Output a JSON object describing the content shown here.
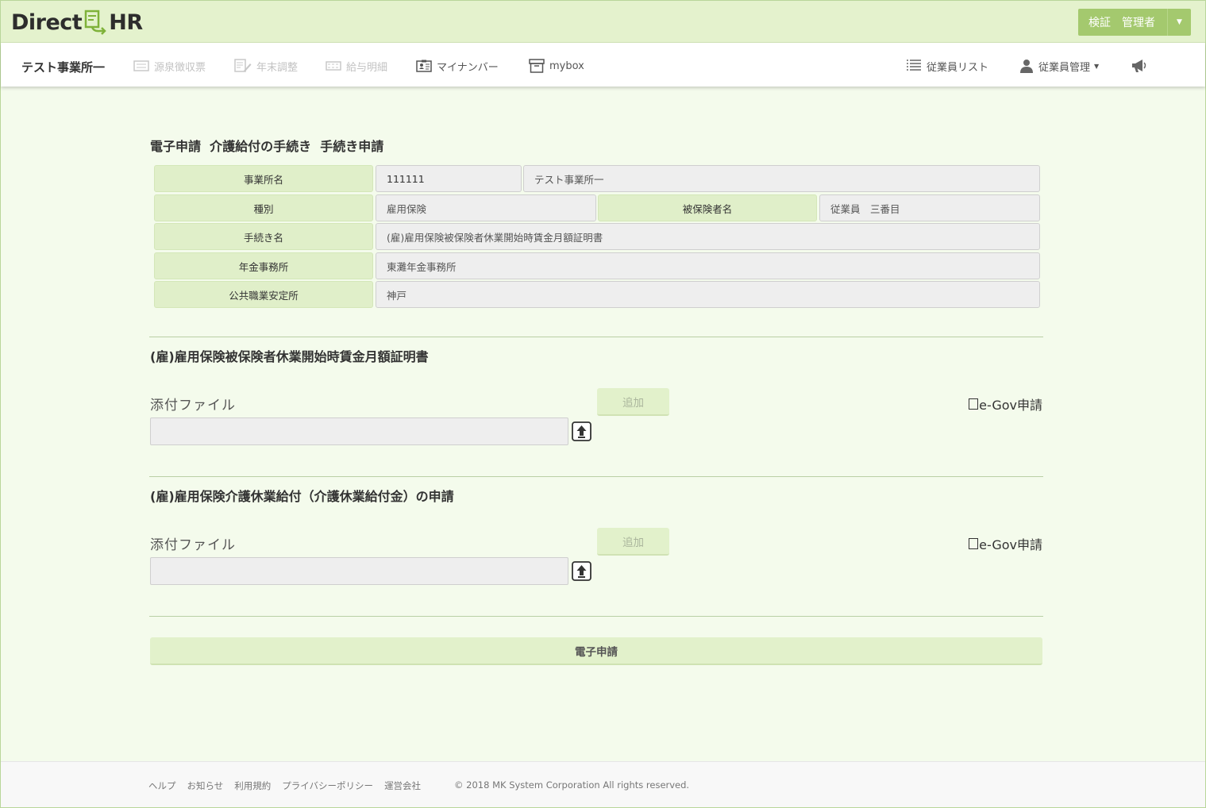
{
  "header": {
    "logo_text_left": "Direct",
    "logo_text_right": "HR",
    "user_label": "検証　管理者"
  },
  "nav": {
    "office": "テスト事業所一",
    "items": [
      {
        "label": "源泉徴収票",
        "icon": "receipt-icon",
        "disabled": true
      },
      {
        "label": "年末調整",
        "icon": "edit-document-icon",
        "disabled": true
      },
      {
        "label": "給与明細",
        "icon": "payslip-icon",
        "disabled": true
      },
      {
        "label": "マイナンバー",
        "icon": "id-card-icon",
        "disabled": false
      },
      {
        "label": "mybox",
        "icon": "archive-box-icon",
        "disabled": false
      }
    ],
    "right": {
      "employee_list": "従業員リスト",
      "employee_manage": "従業員管理"
    }
  },
  "page": {
    "title": "電子申請  介護給付の手続き  手続き申請"
  },
  "info": {
    "office_name_label": "事業所名",
    "office_code": "111111",
    "office_name": "テスト事業所一",
    "type_label": "種別",
    "type_value": "雇用保険",
    "insured_label": "被保険者名",
    "insured_value": "従業員　三番目",
    "procedure_label": "手続き名",
    "procedure_value": "(雇)雇用保険被保険者休業開始時賃金月額証明書",
    "pension_label": "年金事務所",
    "pension_value": "東灘年金事務所",
    "hello_work_label": "公共職業安定所",
    "hello_work_value": "神戸"
  },
  "sections": [
    {
      "title": "(雇)雇用保険被保険者休業開始時賃金月額証明書",
      "attach_label": "添付ファイル",
      "add_label": "追加",
      "egov_label": "e-Gov申請"
    },
    {
      "title": "(雇)雇用保険介護休業給付（介護休業給付金）の申請",
      "attach_label": "添付ファイル",
      "add_label": "追加",
      "egov_label": "e-Gov申請"
    }
  ],
  "submit_label": "電子申請",
  "footer": {
    "links": [
      "ヘルプ",
      "お知らせ",
      "利用規約",
      "プライバシーポリシー",
      "運営会社"
    ],
    "copyright": "© 2018 MK System Corporation All rights reserved."
  },
  "colors": {
    "header_bg": "#e4f2cd",
    "accent": "#a4c96e",
    "label_bg": "#e0efc9",
    "page_bg": "#f4fbec"
  }
}
